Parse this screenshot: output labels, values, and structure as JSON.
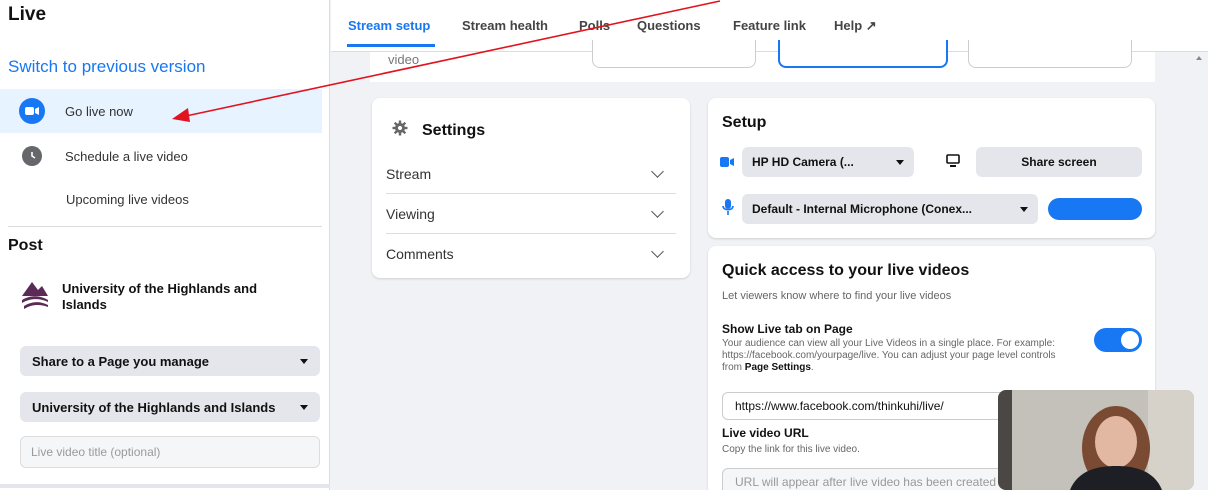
{
  "sidebar": {
    "title": "Live",
    "switch_label": "Switch to previous version",
    "items": [
      {
        "label": "Go live now"
      },
      {
        "label": "Schedule a live video"
      },
      {
        "label": "Upcoming live videos"
      }
    ],
    "post_heading": "Post",
    "page_name": "University of the Highlands and Islands",
    "share_dropdown": "Share to a Page you manage",
    "page_dropdown": "University of the Highlands and Islands",
    "title_placeholder": "Live video title (optional)"
  },
  "tabs": [
    {
      "label": "Stream setup"
    },
    {
      "label": "Stream health"
    },
    {
      "label": "Polls"
    },
    {
      "label": "Questions"
    },
    {
      "label": "Feature link"
    },
    {
      "label": "Help ↗"
    }
  ],
  "top_partial": {
    "video_label": "video"
  },
  "settings": {
    "title": "Settings",
    "rows": [
      {
        "label": "Stream"
      },
      {
        "label": "Viewing"
      },
      {
        "label": "Comments"
      }
    ]
  },
  "setup": {
    "title": "Setup",
    "camera": "HP HD Camera (...",
    "share_screen": "Share screen",
    "microphone": "Default - Internal Microphone (Conex..."
  },
  "quick_access": {
    "title": "Quick access to your live videos",
    "subtitle": "Let viewers know where to find your live videos",
    "show_tab_label": "Show Live tab on Page",
    "desc_main": "Your audience can view all your Live Videos in a single place. For example: https://facebook.com/yourpage/live. You can adjust your page level controls from",
    "desc_link": "Page Settings",
    "desc_end": ".",
    "toggle_on": true,
    "live_url_value": "https://www.facebook.com/thinkuhi/live/",
    "live_video_url_label": "Live video URL",
    "copy_text": "Copy the link for this live video.",
    "url_placeholder": "URL will appear after live video has been created"
  },
  "colors": {
    "accent": "#1877f2",
    "annotation": "#e0141e"
  }
}
